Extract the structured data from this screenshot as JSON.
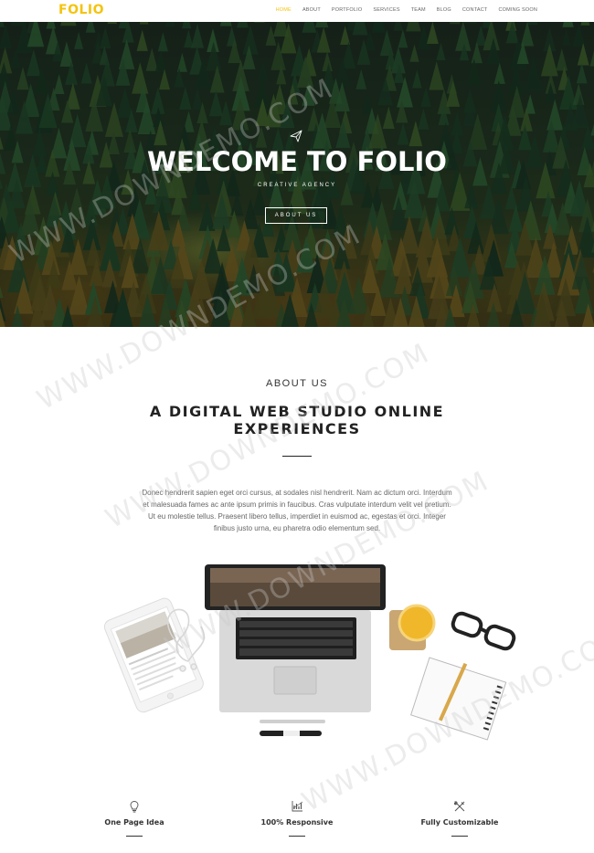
{
  "nav": {
    "logo": "FOLIO",
    "items": [
      {
        "label": "HOME",
        "active": true
      },
      {
        "label": "ABOUT",
        "active": false
      },
      {
        "label": "PORTFOLIO",
        "active": false
      },
      {
        "label": "SERVICES",
        "active": false
      },
      {
        "label": "TEAM",
        "active": false
      },
      {
        "label": "BLOG",
        "active": false
      },
      {
        "label": "CONTACT",
        "active": false
      },
      {
        "label": "COMING SOON",
        "active": false
      }
    ]
  },
  "hero": {
    "icon": "paper-plane-icon",
    "title": "WELCOME TO FOLIO",
    "subtitle": "CREATIVE AGENCY",
    "button": "ABOUT US"
  },
  "about": {
    "label": "ABOUT US",
    "title": "A DIGITAL WEB STUDIO ONLINE EXPERIENCES",
    "text": "Donec hendrerit sapien eget orci cursus, at sodales nisl hendrerit. Nam ac dictum orci. Interdum et malesuada fames ac ante ipsum primis in faucibus. Cras vulputate interdum velit vel pretium. Ut eu molestie tellus. Praesent libero tellus, imperdiet in euismod ac, egestas et orci. Integer finibus justo urna, eu pharetra odio elementum sed."
  },
  "features": [
    {
      "icon": "lightbulb-icon",
      "title": "One Page Idea"
    },
    {
      "icon": "responsive-chart-icon",
      "title": "100% Responsive"
    },
    {
      "icon": "tools-icon",
      "title": "Fully Customizable"
    }
  ],
  "watermark": "WWW.DOWNDEMO.COM",
  "colors": {
    "accent": "#f4c40f"
  }
}
